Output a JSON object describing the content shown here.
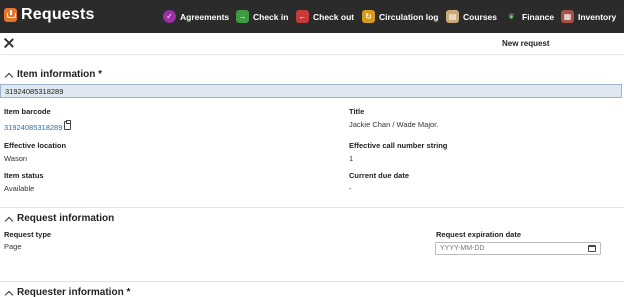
{
  "app": {
    "title": "Requests",
    "nav": [
      {
        "label": "Agreements",
        "icon": "agreements-icon"
      },
      {
        "label": "Check in",
        "icon": "check-in-icon"
      },
      {
        "label": "Check out",
        "icon": "check-out-icon"
      },
      {
        "label": "Circulation log",
        "icon": "circulation-log-icon"
      },
      {
        "label": "Courses",
        "icon": "courses-icon"
      },
      {
        "label": "Finance",
        "icon": "finance-icon"
      },
      {
        "label": "Inventory",
        "icon": "inventory-icon"
      }
    ]
  },
  "pane": {
    "title": "New request"
  },
  "item_information": {
    "heading": "Item information *",
    "barcode_input_value": "31924085318289",
    "item_barcode_label": "Item barcode",
    "item_barcode_value": "31924085318289",
    "title_label": "Title",
    "title_value": "Jackie Chan / Wade Major.",
    "effective_location_label": "Effective location",
    "effective_location_value": "Wason",
    "call_number_label": "Effective call number string",
    "call_number_value": "1",
    "item_status_label": "Item status",
    "item_status_value": "Available",
    "due_date_label": "Current due date",
    "due_date_value": "-"
  },
  "request_information": {
    "heading": "Request information",
    "request_type_label": "Request type",
    "request_type_value": "Page",
    "expiration_label": "Request expiration date",
    "expiration_placeholder": "YYYY-MM-DD"
  },
  "requester_information": {
    "heading": "Requester information *"
  },
  "colors": {
    "topbar": "#2b2b2b",
    "link": "#2e6ea8",
    "input_highlight": "#dfe8f1"
  }
}
